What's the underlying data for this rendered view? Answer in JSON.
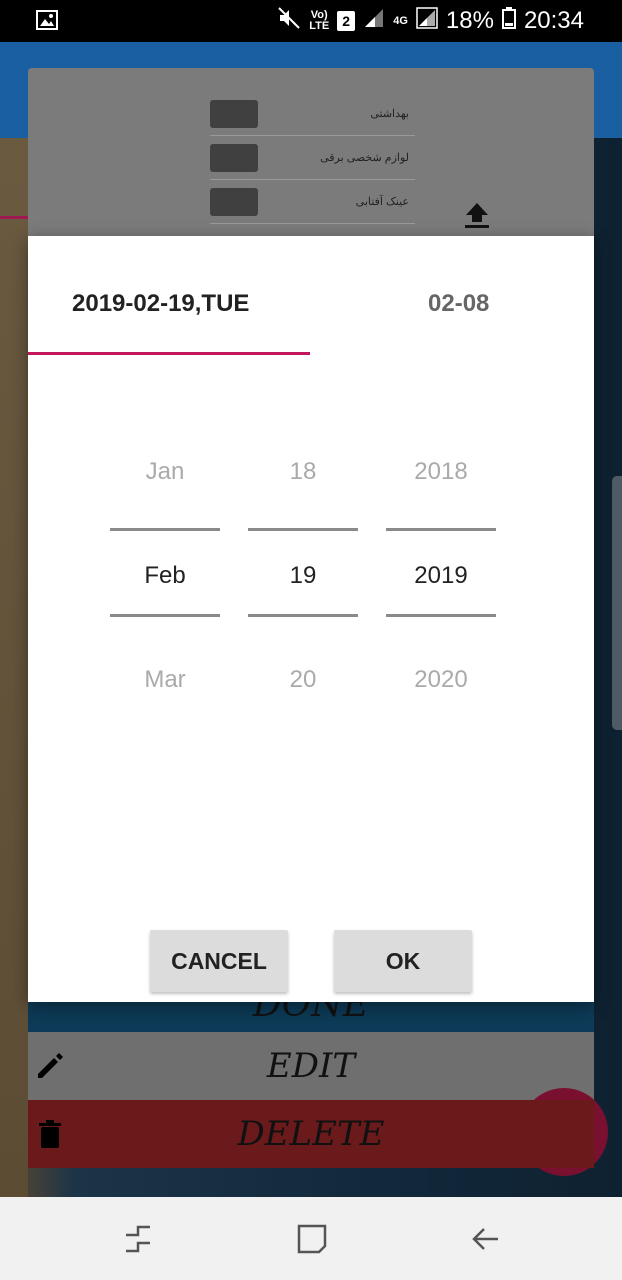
{
  "status_bar": {
    "volte_top": "Vo)",
    "volte_bottom": "LTE",
    "sim_slot": "2",
    "network_type": "4G",
    "battery_percent": "18%",
    "time": "20:34"
  },
  "background": {
    "list_items": [
      {
        "label": "بهداشتی"
      },
      {
        "label": "لوازم شخصی برقی"
      },
      {
        "label": "عینک آفتابی"
      }
    ],
    "done_label": "DONE",
    "edit_label": "EDIT",
    "delete_label": "DELETE"
  },
  "dialog": {
    "date_tab_label": "2019-02-19,TUE",
    "time_tab_label": "02-08",
    "month": {
      "prev": "Jan",
      "current": "Feb",
      "next": "Mar"
    },
    "day": {
      "prev": "18",
      "current": "19",
      "next": "20"
    },
    "year": {
      "prev": "2018",
      "current": "2019",
      "next": "2020"
    },
    "cancel_label": "CANCEL",
    "ok_label": "OK"
  },
  "colors": {
    "accent": "#c2185b",
    "app_bar": "#1b5fa3",
    "delete_row": "#6b1a1c"
  }
}
